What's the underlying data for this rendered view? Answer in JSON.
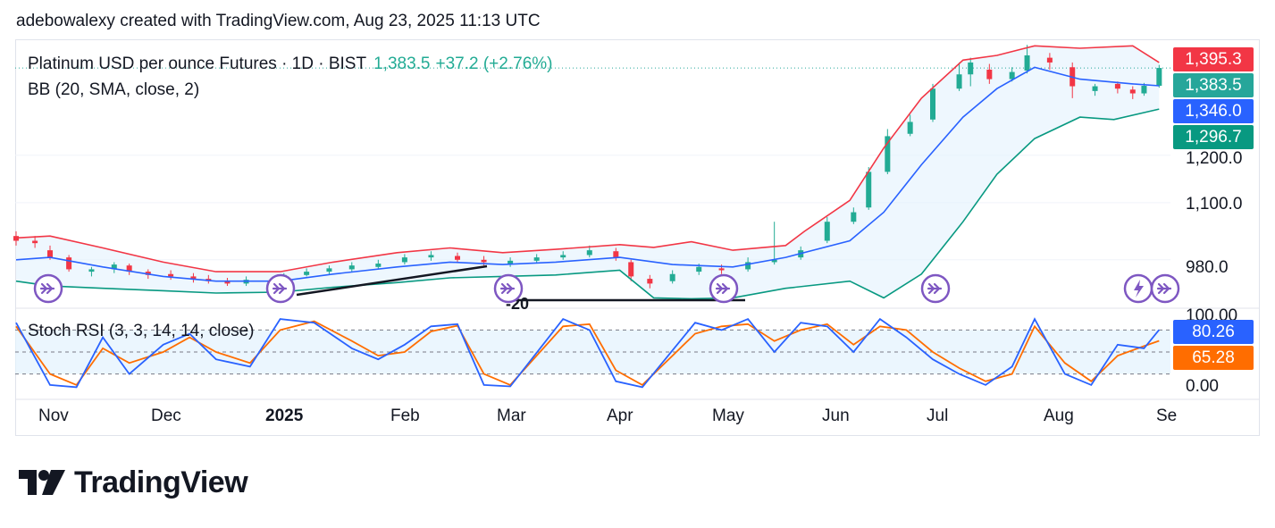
{
  "header": {
    "text": "adebowalexy created with TradingView.com, Aug 23, 2025 11:13 UTC"
  },
  "legend": {
    "symbol": "Platinum USD per ounce Futures · 1D · BIST",
    "price": "1,383.5",
    "change": "+37.2 (+2.76%)",
    "bb": "BB (20, SMA, close, 2)",
    "stoch": "Stoch RSI (3, 3, 14, 14, close)"
  },
  "price_tags": {
    "upper": "1,395.3",
    "last": "1,383.5",
    "basis": "1,346.0",
    "lower": "1,296.7",
    "stoch_k": "80.26",
    "stoch_d": "65.28"
  },
  "colors": {
    "up": "#22ab94",
    "down": "#f23645",
    "bb_upper": "#f23645",
    "bb_basis": "#2962ff",
    "bb_lower": "#089981",
    "bb_fill": "#e3f2fd",
    "stoch_k": "#2962ff",
    "stoch_d": "#ff6d00",
    "tag_upper": "#f23645",
    "tag_last": "#26a69a",
    "tag_basis": "#2962ff",
    "tag_lower": "#089981",
    "tag_k": "#2962ff",
    "tag_d": "#ff6d00",
    "event_icon": "#7e57c2"
  },
  "axes": {
    "price_ticks": [
      "1,200.0",
      "1,100.0",
      "980.0"
    ],
    "stoch_ticks": [
      "100.00",
      "0.00"
    ],
    "months": [
      "Nov",
      "Dec",
      "2025",
      "Feb",
      "Mar",
      "Apr",
      "May",
      "Jun",
      "Jul",
      "Aug",
      "Se"
    ]
  },
  "drawing": {
    "label": "-20"
  },
  "logo": {
    "text": "TradingView"
  },
  "chart_data": {
    "type": "candlestick",
    "title": "Platinum USD per ounce Futures · 1D · BIST",
    "ylim": [
      880,
      1440
    ],
    "x_range": [
      "2024-10-23",
      "2025-08-25"
    ],
    "bb_upper": [
      [
        "2024-10-23",
        1026
      ],
      [
        "2024-11-01",
        1030
      ],
      [
        "2024-11-15",
        1005
      ],
      [
        "2024-12-01",
        975
      ],
      [
        "2024-12-15",
        955
      ],
      [
        "2025-01-01",
        955
      ],
      [
        "2025-01-15",
        975
      ],
      [
        "2025-02-01",
        995
      ],
      [
        "2025-02-15",
        1005
      ],
      [
        "2025-03-01",
        995
      ],
      [
        "2025-03-15",
        1002
      ],
      [
        "2025-04-01",
        1012
      ],
      [
        "2025-04-10",
        1006
      ],
      [
        "2025-04-20",
        1018
      ],
      [
        "2025-05-01",
        1000
      ],
      [
        "2025-05-15",
        1010
      ],
      [
        "2025-05-20",
        1040
      ],
      [
        "2025-06-01",
        1105
      ],
      [
        "2025-06-10",
        1215
      ],
      [
        "2025-06-20",
        1320
      ],
      [
        "2025-07-01",
        1400
      ],
      [
        "2025-07-10",
        1410
      ],
      [
        "2025-07-20",
        1430
      ],
      [
        "2025-08-01",
        1425
      ],
      [
        "2025-08-15",
        1430
      ],
      [
        "2025-08-22",
        1395
      ]
    ],
    "bb_basis": [
      [
        "2024-10-23",
        980
      ],
      [
        "2024-11-01",
        985
      ],
      [
        "2024-11-15",
        965
      ],
      [
        "2024-12-01",
        945
      ],
      [
        "2024-12-15",
        935
      ],
      [
        "2025-01-01",
        935
      ],
      [
        "2025-01-15",
        950
      ],
      [
        "2025-02-01",
        965
      ],
      [
        "2025-02-15",
        975
      ],
      [
        "2025-03-01",
        970
      ],
      [
        "2025-03-15",
        975
      ],
      [
        "2025-04-01",
        985
      ],
      [
        "2025-04-15",
        970
      ],
      [
        "2025-05-01",
        965
      ],
      [
        "2025-05-15",
        985
      ],
      [
        "2025-06-01",
        1020
      ],
      [
        "2025-06-10",
        1080
      ],
      [
        "2025-06-20",
        1180
      ],
      [
        "2025-07-01",
        1280
      ],
      [
        "2025-07-10",
        1340
      ],
      [
        "2025-07-20",
        1385
      ],
      [
        "2025-08-01",
        1360
      ],
      [
        "2025-08-15",
        1350
      ],
      [
        "2025-08-22",
        1346
      ]
    ],
    "bb_lower": [
      [
        "2024-10-23",
        935
      ],
      [
        "2024-11-01",
        925
      ],
      [
        "2024-11-15",
        920
      ],
      [
        "2024-12-01",
        915
      ],
      [
        "2024-12-15",
        910
      ],
      [
        "2025-01-01",
        912
      ],
      [
        "2025-01-15",
        922
      ],
      [
        "2025-02-01",
        932
      ],
      [
        "2025-02-15",
        942
      ],
      [
        "2025-03-01",
        945
      ],
      [
        "2025-03-15",
        948
      ],
      [
        "2025-04-01",
        958
      ],
      [
        "2025-04-10",
        900
      ],
      [
        "2025-04-20",
        898
      ],
      [
        "2025-05-01",
        900
      ],
      [
        "2025-05-15",
        920
      ],
      [
        "2025-06-01",
        935
      ],
      [
        "2025-06-10",
        900
      ],
      [
        "2025-06-20",
        950
      ],
      [
        "2025-07-01",
        1060
      ],
      [
        "2025-07-10",
        1160
      ],
      [
        "2025-07-20",
        1235
      ],
      [
        "2025-08-01",
        1280
      ],
      [
        "2025-08-10",
        1275
      ],
      [
        "2025-08-22",
        1297
      ]
    ],
    "candles": [
      [
        "2024-10-23",
        1030,
        1020,
        1040,
        1010
      ],
      [
        "2024-10-28",
        1020,
        1015,
        1030,
        1005
      ],
      [
        "2024-11-01",
        1000,
        985,
        1010,
        980
      ],
      [
        "2024-11-06",
        985,
        960,
        990,
        955
      ],
      [
        "2024-11-12",
        955,
        960,
        965,
        945
      ],
      [
        "2024-11-18",
        960,
        970,
        975,
        952
      ],
      [
        "2024-11-22",
        968,
        955,
        972,
        948
      ],
      [
        "2024-11-27",
        955,
        948,
        960,
        940
      ],
      [
        "2024-12-03",
        950,
        945,
        958,
        938
      ],
      [
        "2024-12-09",
        945,
        940,
        952,
        932
      ],
      [
        "2024-12-13",
        940,
        935,
        948,
        930
      ],
      [
        "2024-12-18",
        935,
        930,
        942,
        925
      ],
      [
        "2024-12-23",
        930,
        938,
        945,
        925
      ],
      [
        "2025-01-02",
        932,
        948,
        952,
        928
      ],
      [
        "2025-01-08",
        948,
        955,
        962,
        945
      ],
      [
        "2025-01-14",
        955,
        962,
        968,
        950
      ],
      [
        "2025-01-20",
        960,
        968,
        975,
        955
      ],
      [
        "2025-01-27",
        965,
        972,
        980,
        960
      ],
      [
        "2025-02-03",
        975,
        985,
        992,
        970
      ],
      [
        "2025-02-10",
        985,
        990,
        998,
        978
      ],
      [
        "2025-02-17",
        988,
        980,
        995,
        975
      ],
      [
        "2025-02-24",
        980,
        975,
        988,
        968
      ],
      [
        "2025-03-03",
        972,
        978,
        985,
        965
      ],
      [
        "2025-03-10",
        978,
        985,
        992,
        972
      ],
      [
        "2025-03-17",
        985,
        990,
        998,
        980
      ],
      [
        "2025-03-24",
        990,
        1000,
        1010,
        985
      ],
      [
        "2025-03-31",
        998,
        985,
        1005,
        978
      ],
      [
        "2025-04-04",
        975,
        945,
        980,
        935
      ],
      [
        "2025-04-09",
        940,
        930,
        948,
        920
      ],
      [
        "2025-04-15",
        935,
        950,
        958,
        930
      ],
      [
        "2025-04-22",
        955,
        965,
        972,
        948
      ],
      [
        "2025-04-28",
        962,
        958,
        970,
        950
      ],
      [
        "2025-05-05",
        960,
        975,
        985,
        955
      ],
      [
        "2025-05-12",
        975,
        980,
        1060,
        970
      ],
      [
        "2025-05-19",
        985,
        1000,
        1008,
        980
      ],
      [
        "2025-05-26",
        1020,
        1060,
        1070,
        1015
      ],
      [
        "2025-06-02",
        1060,
        1080,
        1090,
        1055
      ],
      [
        "2025-06-06",
        1090,
        1165,
        1175,
        1085
      ],
      [
        "2025-06-11",
        1165,
        1240,
        1255,
        1160
      ],
      [
        "2025-06-17",
        1245,
        1270,
        1285,
        1240
      ],
      [
        "2025-06-23",
        1275,
        1340,
        1350,
        1270
      ],
      [
        "2025-06-30",
        1340,
        1370,
        1395,
        1335
      ],
      [
        "2025-07-03",
        1370,
        1395,
        1405,
        1345
      ],
      [
        "2025-07-08",
        1380,
        1360,
        1392,
        1350
      ],
      [
        "2025-07-14",
        1360,
        1375,
        1385,
        1355
      ],
      [
        "2025-07-18",
        1378,
        1410,
        1432,
        1372
      ],
      [
        "2025-07-24",
        1405,
        1395,
        1415,
        1380
      ],
      [
        "2025-07-30",
        1385,
        1345,
        1395,
        1320
      ],
      [
        "2025-08-05",
        1335,
        1345,
        1350,
        1325
      ],
      [
        "2025-08-11",
        1350,
        1340,
        1355,
        1330
      ],
      [
        "2025-08-15",
        1338,
        1330,
        1345,
        1318
      ],
      [
        "2025-08-18",
        1330,
        1346,
        1352,
        1325
      ],
      [
        "2025-08-22",
        1346,
        1383.5,
        1390,
        1342
      ]
    ],
    "stoch_rsi": {
      "ylim": [
        0,
        100
      ],
      "k": [
        [
          "2024-10-23",
          90
        ],
        [
          "2024-11-01",
          5
        ],
        [
          "2024-11-08",
          2
        ],
        [
          "2024-11-15",
          70
        ],
        [
          "2024-11-22",
          20
        ],
        [
          "2024-12-01",
          60
        ],
        [
          "2024-12-08",
          75
        ],
        [
          "2024-12-15",
          40
        ],
        [
          "2024-12-24",
          30
        ],
        [
          "2025-01-01",
          95
        ],
        [
          "2025-01-10",
          90
        ],
        [
          "2025-01-20",
          55
        ],
        [
          "2025-01-27",
          40
        ],
        [
          "2025-02-03",
          60
        ],
        [
          "2025-02-10",
          85
        ],
        [
          "2025-02-17",
          88
        ],
        [
          "2025-02-24",
          5
        ],
        [
          "2025-03-03",
          3
        ],
        [
          "2025-03-17",
          95
        ],
        [
          "2025-03-24",
          80
        ],
        [
          "2025-03-31",
          10
        ],
        [
          "2025-04-07",
          2
        ],
        [
          "2025-04-21",
          90
        ],
        [
          "2025-04-28",
          80
        ],
        [
          "2025-05-05",
          95
        ],
        [
          "2025-05-12",
          50
        ],
        [
          "2025-05-19",
          90
        ],
        [
          "2025-05-26",
          85
        ],
        [
          "2025-06-02",
          50
        ],
        [
          "2025-06-09",
          95
        ],
        [
          "2025-06-16",
          70
        ],
        [
          "2025-06-23",
          40
        ],
        [
          "2025-06-30",
          20
        ],
        [
          "2025-07-07",
          5
        ],
        [
          "2025-07-14",
          30
        ],
        [
          "2025-07-20",
          95
        ],
        [
          "2025-07-28",
          20
        ],
        [
          "2025-08-04",
          5
        ],
        [
          "2025-08-11",
          60
        ],
        [
          "2025-08-18",
          55
        ],
        [
          "2025-08-22",
          80.26
        ]
      ],
      "d": [
        [
          "2024-10-23",
          85
        ],
        [
          "2024-11-01",
          20
        ],
        [
          "2024-11-08",
          5
        ],
        [
          "2024-11-15",
          55
        ],
        [
          "2024-11-22",
          35
        ],
        [
          "2024-12-01",
          50
        ],
        [
          "2024-12-08",
          70
        ],
        [
          "2024-12-15",
          50
        ],
        [
          "2024-12-24",
          35
        ],
        [
          "2025-01-01",
          80
        ],
        [
          "2025-01-10",
          92
        ],
        [
          "2025-01-20",
          65
        ],
        [
          "2025-01-27",
          45
        ],
        [
          "2025-02-03",
          50
        ],
        [
          "2025-02-10",
          78
        ],
        [
          "2025-02-17",
          86
        ],
        [
          "2025-02-24",
          20
        ],
        [
          "2025-03-03",
          5
        ],
        [
          "2025-03-17",
          85
        ],
        [
          "2025-03-24",
          88
        ],
        [
          "2025-03-31",
          25
        ],
        [
          "2025-04-07",
          5
        ],
        [
          "2025-04-21",
          75
        ],
        [
          "2025-04-28",
          85
        ],
        [
          "2025-05-05",
          88
        ],
        [
          "2025-05-12",
          65
        ],
        [
          "2025-05-19",
          80
        ],
        [
          "2025-05-26",
          88
        ],
        [
          "2025-06-02",
          60
        ],
        [
          "2025-06-09",
          85
        ],
        [
          "2025-06-16",
          80
        ],
        [
          "2025-06-23",
          50
        ],
        [
          "2025-06-30",
          28
        ],
        [
          "2025-07-07",
          10
        ],
        [
          "2025-07-14",
          20
        ],
        [
          "2025-07-20",
          85
        ],
        [
          "2025-07-28",
          35
        ],
        [
          "2025-08-04",
          10
        ],
        [
          "2025-08-11",
          45
        ],
        [
          "2025-08-18",
          58
        ],
        [
          "2025-08-22",
          65.28
        ]
      ]
    }
  }
}
